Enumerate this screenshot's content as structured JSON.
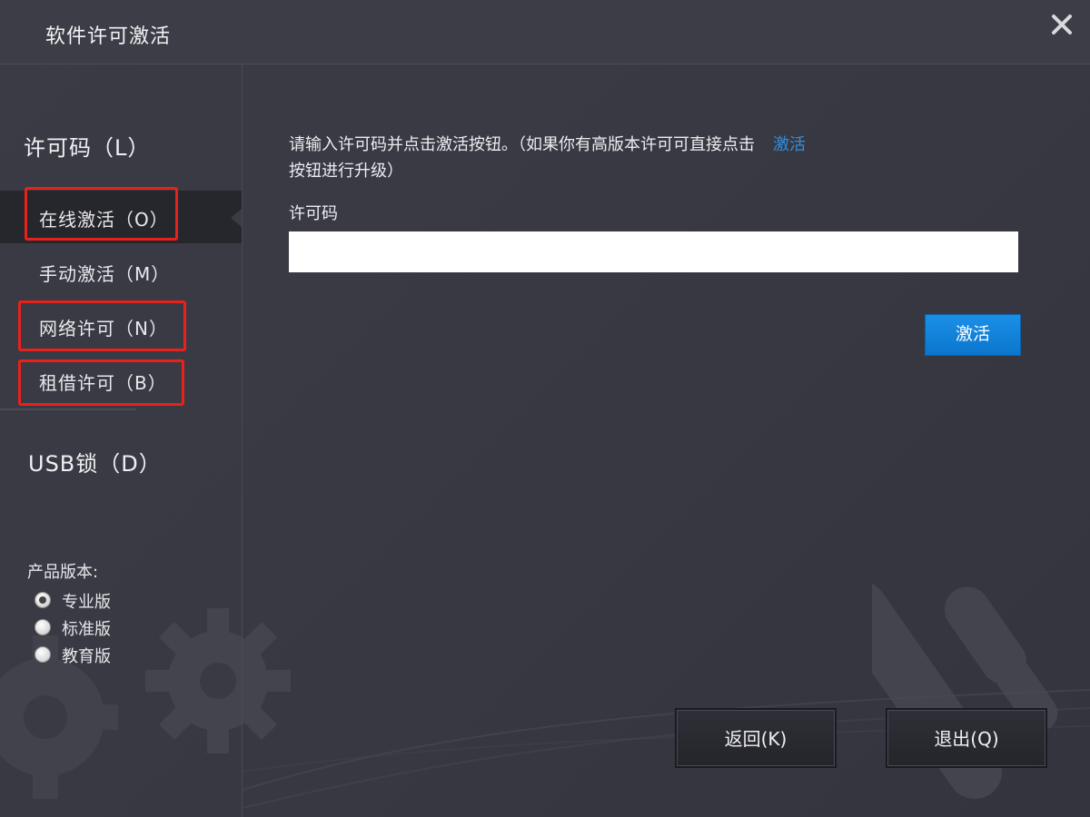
{
  "window": {
    "title": "软件许可激活"
  },
  "sidebar": {
    "section_license": "许可码（L）",
    "items": [
      {
        "label": "在线激活（O）"
      },
      {
        "label": "手动激活（M）"
      },
      {
        "label": "网络许可（N）"
      },
      {
        "label": "租借许可（B）"
      }
    ],
    "section_usb": "USB锁（D）",
    "edition": {
      "title": "产品版本:",
      "options": [
        {
          "label": "专业版",
          "checked": true
        },
        {
          "label": "标准版",
          "checked": false
        },
        {
          "label": "教育版",
          "checked": false
        }
      ]
    }
  },
  "main": {
    "instruction_text": "请输入许可码并点击激活按钮。（如果你有高版本许可可直接点击",
    "instruction_link": "激活",
    "instruction_text_2": "按钮进行升级）",
    "license_label": "许可码",
    "license_value": "",
    "activate_label": "激活"
  },
  "footer": {
    "back_label": "返回(K)",
    "exit_label": "退出(Q)"
  },
  "colors": {
    "background": "#3a3a44",
    "active_item": "#26262d",
    "accent": "#1a8fe8",
    "highlight": "#e8221b",
    "link": "#2f8fe0"
  }
}
